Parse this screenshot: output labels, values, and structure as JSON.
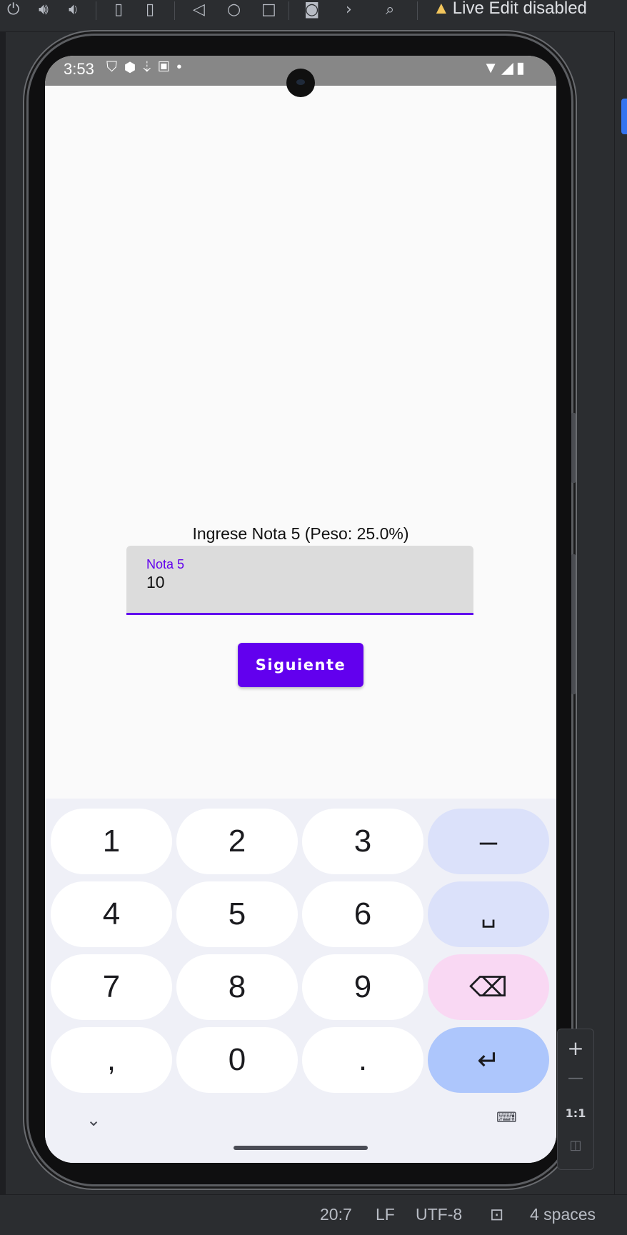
{
  "ide": {
    "toolbar": {
      "live_edit_text": "Live Edit disabled",
      "icons": [
        "power-icon",
        "volume-up-icon",
        "volume-down-icon",
        "rotate-left-icon",
        "rotate-right-icon",
        "back-icon",
        "home-icon",
        "overview-icon",
        "screenshot-icon",
        "more-icon",
        "layout-inspector-icon",
        "warning-icon"
      ]
    },
    "status_bar": {
      "position": "20:7",
      "line_ending": "LF",
      "encoding": "UTF-8",
      "indent": "4 spaces"
    },
    "zoom_panel": {
      "zoom_in": "+",
      "zoom_out": "—",
      "one_to_one": "1:1"
    }
  },
  "device": {
    "status_bar": {
      "time": "3:53",
      "icons": [
        "vpn-icon",
        "shield-icon",
        "download-icon",
        "a-icon",
        "dot-icon"
      ],
      "right_icons": [
        "wifi-icon",
        "signal-icon",
        "battery-icon"
      ]
    },
    "app": {
      "prompt": "Ingrese Nota 5 (Peso: 25.0%)",
      "field": {
        "label": "Nota 5",
        "value": "10"
      },
      "button_label": "Siguiente",
      "accent_color": "#6200ee"
    },
    "keyboard": {
      "rows": [
        [
          "1",
          "2",
          "3",
          "–"
        ],
        [
          "4",
          "5",
          "6",
          "␣"
        ],
        [
          "7",
          "8",
          "9",
          "⌫"
        ],
        [
          ",",
          "0",
          ".",
          "↵"
        ]
      ],
      "hide_keyboard_icon": "chevron-down-icon",
      "switch_keyboard_icon": "keyboard-icon"
    }
  }
}
